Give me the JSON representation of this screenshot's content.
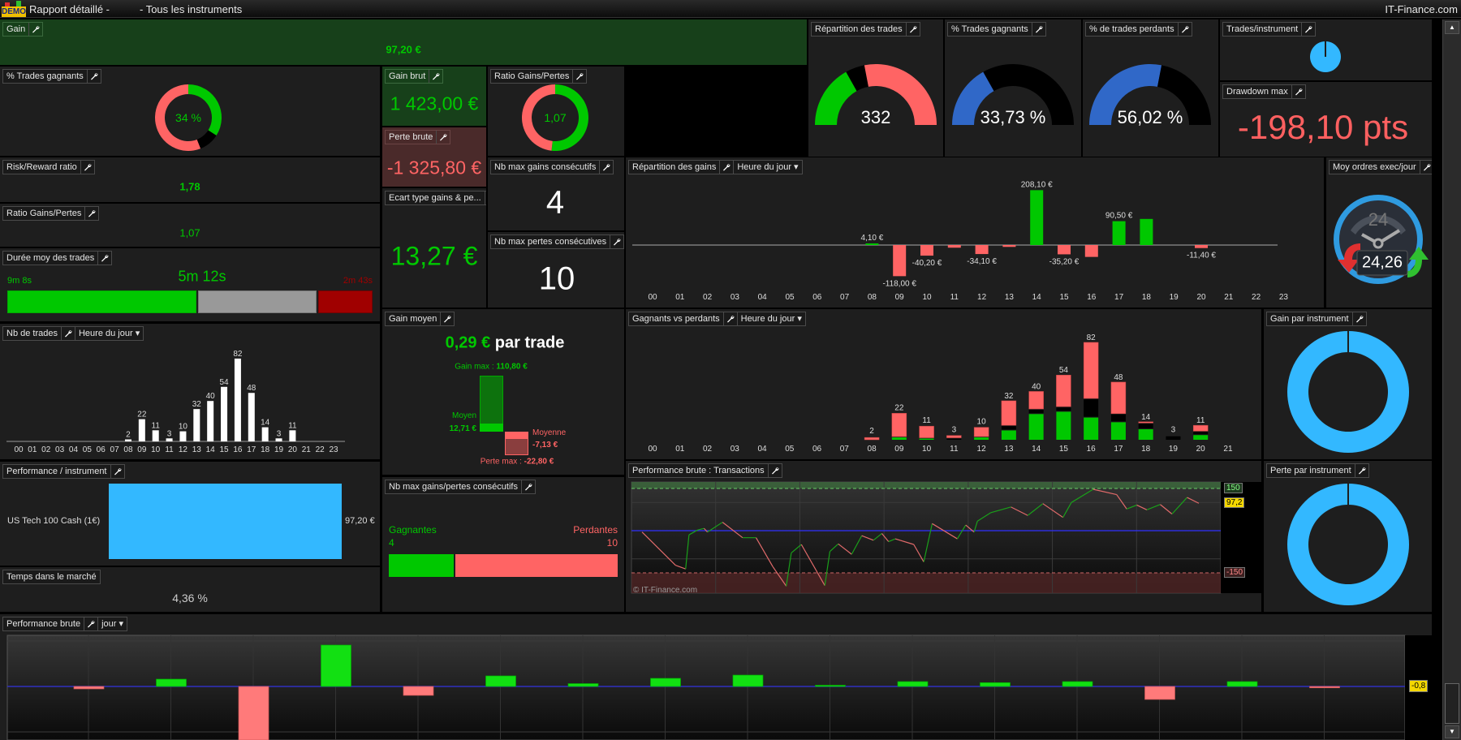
{
  "app": {
    "demo_badge": "DEMO",
    "title": "Rapport détaillé -",
    "subtitle": "- Tous les instruments",
    "brand": "IT-Finance.com"
  },
  "panels": {
    "gain": {
      "title": "Gain",
      "value": "97,20 €"
    },
    "pct_win_donut": {
      "title": "% Trades gagnants",
      "value": "34 %"
    },
    "gain_brut": {
      "title": "Gain brut",
      "value": "1 423,00 €"
    },
    "ratio_donut": {
      "title": "Ratio Gains/Pertes",
      "value": "1,07"
    },
    "repartition_trades": {
      "title": "Répartition des trades",
      "value": "332"
    },
    "pct_win_gauge": {
      "title": "% Trades gagnants",
      "value": "33,73 %"
    },
    "pct_loss_gauge": {
      "title": "% de trades perdants",
      "value": "56,02 %"
    },
    "trades_instrument": {
      "title": "Trades/instrument"
    },
    "drawdown": {
      "title": "Drawdown max",
      "value": "-198,10 pts"
    },
    "risk_reward": {
      "title": "Risk/Reward ratio",
      "value": "1,78"
    },
    "perte_brute": {
      "title": "Perte brute",
      "value": "-1 325,80 €"
    },
    "nb_max_gains": {
      "title": "Nb max gains consécutifs",
      "value": "4"
    },
    "repartition_gains": {
      "title": "Répartition des gains",
      "dropdown": "Heure du jour"
    },
    "moy_ordres": {
      "title": "Moy ordres exec/jour",
      "value": "24,26",
      "icon_number": "24"
    },
    "ratio_text": {
      "title": "Ratio Gains/Pertes",
      "value": "1,07"
    },
    "ecart_type": {
      "title": "Ecart type gains & pe...",
      "value": "13,27 €"
    },
    "nb_max_pertes": {
      "title": "Nb max pertes consécutives",
      "value": "10"
    },
    "duree": {
      "title": "Durée moy des trades",
      "value": "5m 12s",
      "win": "9m 8s",
      "loss": "2m 43s"
    },
    "nb_trades": {
      "title": "Nb de trades",
      "dropdown": "Heure du jour"
    },
    "gain_moyen": {
      "title": "Gain moyen",
      "value": "0,29 €",
      "suffix": "par trade",
      "gain_max_label": "Gain max :",
      "gain_max": "110,80 €",
      "moyen_label": "Moyen",
      "moyen": "12,71 €",
      "moyenne_label": "Moyenne",
      "moyenne": "-7,13 €",
      "perte_max_label": "Perte max :",
      "perte_max": "-22,80 €"
    },
    "gagnants_perdants": {
      "title": "Gagnants vs perdants",
      "dropdown": "Heure du jour"
    },
    "gain_instrument": {
      "title": "Gain par instrument"
    },
    "perf_instrument": {
      "title": "Performance / instrument",
      "instrument": "US Tech 100 Cash (1€)",
      "value": "97,20 €"
    },
    "perf_transactions": {
      "title": "Performance brute : Transactions",
      "watermark": "© IT-Finance.com",
      "upper": "150",
      "lower": "-150",
      "last": "97,2"
    },
    "nb_max_consec": {
      "title": "Nb max gains/pertes consécutifs",
      "win_label": "Gagnantes",
      "win": "4",
      "loss_label": "Perdantes",
      "loss": "10"
    },
    "perte_instrument": {
      "title": "Perte par instrument"
    },
    "temps": {
      "title": "Temps dans le marché",
      "value": "4,36 %"
    },
    "perf_brute": {
      "title": "Performance brute",
      "dropdown": "jour",
      "last": "-0,8"
    }
  },
  "colors": {
    "win": "#00c800",
    "loss": "#ff6464",
    "neutral": "#000000",
    "gauge_blue": "#3068c8",
    "instrument_blue": "#33b8ff",
    "panel_bg": "#1e1e1e",
    "gain_bg": "#17401a",
    "loss_bg": "#4a2a2a",
    "highlight": "#f5d800"
  },
  "chart_data": [
    {
      "id": "nb_trades",
      "type": "bar",
      "categories": [
        "00",
        "01",
        "02",
        "03",
        "04",
        "05",
        "06",
        "07",
        "08",
        "09",
        "10",
        "11",
        "12",
        "13",
        "14",
        "15",
        "16",
        "17",
        "18",
        "19",
        "20",
        "21",
        "22",
        "23"
      ],
      "values": [
        0,
        0,
        0,
        0,
        0,
        0,
        0,
        0,
        2,
        22,
        11,
        3,
        10,
        32,
        40,
        54,
        82,
        48,
        14,
        3,
        11,
        0,
        0,
        0
      ]
    },
    {
      "id": "repartition_gains",
      "type": "bar",
      "categories": [
        "00",
        "01",
        "02",
        "03",
        "04",
        "05",
        "06",
        "07",
        "08",
        "09",
        "10",
        "11",
        "12",
        "13",
        "14",
        "15",
        "16",
        "17",
        "18",
        "19",
        "20",
        "21",
        "22",
        "23"
      ],
      "values": [
        0,
        0,
        0,
        0,
        0,
        0,
        0,
        0,
        4.1,
        -118.0,
        -40.2,
        -10,
        -34.1,
        -7,
        208.1,
        -35.2,
        -45,
        90.5,
        99,
        0,
        -11.4,
        0,
        0,
        0
      ],
      "labels": [
        null,
        null,
        null,
        null,
        null,
        null,
        null,
        null,
        "4,10 €",
        "-118,00 €",
        "-40,20 €",
        null,
        "-34,10 €",
        null,
        "208,10 €",
        "-35,20 €",
        null,
        "90,50 €",
        null,
        null,
        "-11,40 €",
        null,
        null,
        null
      ]
    },
    {
      "id": "gagnants_perdants",
      "type": "bar",
      "stacked": true,
      "categories": [
        "00",
        "01",
        "02",
        "03",
        "04",
        "05",
        "06",
        "07",
        "08",
        "09",
        "10",
        "11",
        "12",
        "13",
        "14",
        "15",
        "16",
        "17",
        "18",
        "19",
        "20",
        "21"
      ],
      "totals": [
        0,
        0,
        0,
        0,
        0,
        0,
        0,
        0,
        2,
        22,
        11,
        3,
        10,
        32,
        40,
        54,
        82,
        48,
        14,
        3,
        11,
        0
      ],
      "series": [
        {
          "role": "winners",
          "values": [
            0,
            0,
            0,
            0,
            0,
            0,
            0,
            0,
            0,
            2,
            1,
            0,
            2,
            8,
            22,
            24,
            19,
            15,
            9,
            0,
            4,
            0
          ]
        },
        {
          "role": "neutral",
          "values": [
            0,
            0,
            0,
            0,
            0,
            0,
            0,
            0,
            0,
            0,
            0,
            1,
            0,
            3,
            3,
            3,
            15,
            6,
            4,
            3,
            2,
            0
          ]
        },
        {
          "role": "losers",
          "values": [
            0,
            0,
            0,
            0,
            0,
            0,
            0,
            0,
            2,
            20,
            10,
            2,
            8,
            21,
            15,
            27,
            48,
            27,
            1,
            0,
            5,
            0
          ]
        }
      ]
    },
    {
      "id": "perf_transactions",
      "type": "line",
      "xlabel": "",
      "ylabel": "",
      "ylim": [
        -230,
        175
      ],
      "levels": [
        150,
        -150,
        0
      ],
      "points": [
        [
          0,
          -5
        ],
        [
          20,
          -123
        ],
        [
          26,
          -136
        ],
        [
          28,
          -15
        ],
        [
          33,
          2
        ],
        [
          37,
          8
        ],
        [
          39,
          -5
        ],
        [
          48,
          30
        ],
        [
          60,
          -25
        ],
        [
          68,
          -25
        ],
        [
          78,
          -128
        ],
        [
          86,
          -197
        ],
        [
          89,
          -79
        ],
        [
          95,
          -49
        ],
        [
          109,
          -195
        ],
        [
          112,
          -74
        ],
        [
          117,
          -47
        ],
        [
          125,
          -84
        ],
        [
          131,
          -18
        ],
        [
          138,
          -34
        ],
        [
          143,
          -10
        ],
        [
          147,
          -39
        ],
        [
          151,
          -29
        ],
        [
          162,
          -49
        ],
        [
          168,
          -111
        ],
        [
          173,
          25
        ],
        [
          188,
          -29
        ],
        [
          193,
          20
        ],
        [
          198,
          -5
        ],
        [
          200,
          34
        ],
        [
          208,
          64
        ],
        [
          220,
          84
        ],
        [
          230,
          54
        ],
        [
          239,
          96
        ],
        [
          251,
          47
        ],
        [
          256,
          100
        ],
        [
          269,
          147
        ],
        [
          283,
          128
        ],
        [
          289,
          77
        ],
        [
          295,
          91
        ],
        [
          301,
          74
        ],
        [
          309,
          93
        ],
        [
          316,
          59
        ],
        [
          325,
          118
        ],
        [
          332,
          97.2
        ]
      ]
    },
    {
      "id": "perf_brute",
      "type": "bar",
      "ylim": [
        -66,
        64
      ],
      "values": [
        -3,
        9,
        -80,
        51,
        -11,
        13,
        3.5,
        10,
        14,
        1.3,
        6,
        4.7,
        6,
        -16,
        6,
        -1.7
      ]
    },
    {
      "id": "pct_win_donut",
      "type": "pie",
      "values": [
        34,
        10,
        56
      ],
      "roles": [
        "winners",
        "neutral",
        "losers"
      ]
    },
    {
      "id": "ratio_donut",
      "type": "pie",
      "values": [
        1423.0,
        1325.8
      ],
      "roles": [
        "gains",
        "pertes"
      ]
    },
    {
      "id": "repartition_trades",
      "type": "pie",
      "half": true,
      "values": [
        112,
        34,
        186
      ],
      "roles": [
        "winners",
        "neutral",
        "losers"
      ]
    },
    {
      "id": "pct_win_gauge",
      "type": "pie",
      "half": true,
      "values": [
        33.73,
        66.27
      ]
    },
    {
      "id": "pct_loss_gauge",
      "type": "pie",
      "half": true,
      "values": [
        56.02,
        43.98
      ]
    },
    {
      "id": "trades_instrument",
      "type": "pie",
      "categories": [
        "US Tech 100 Cash (1€)"
      ],
      "values": [
        100
      ]
    },
    {
      "id": "gain_instrument",
      "type": "pie",
      "categories": [
        "US Tech 100 Cash (1€)"
      ],
      "values": [
        100
      ]
    },
    {
      "id": "perte_instrument",
      "type": "pie",
      "categories": [
        "US Tech 100 Cash (1€)"
      ],
      "values": [
        100
      ]
    }
  ]
}
